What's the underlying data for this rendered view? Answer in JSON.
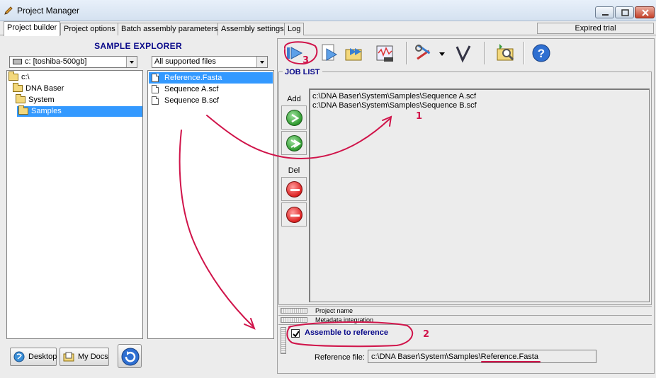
{
  "window": {
    "title": "Project Manager",
    "app_icon": "pencil-icon"
  },
  "tabs": [
    {
      "label": "Project builder",
      "active": true
    },
    {
      "label": "Project options",
      "active": false
    },
    {
      "label": "Batch assembly parameters",
      "active": false
    },
    {
      "label": "Assembly settings",
      "active": false
    },
    {
      "label": "Log",
      "active": false
    }
  ],
  "status": {
    "license": "Expired trial"
  },
  "explorer": {
    "title": "SAMPLE EXPLORER",
    "drive": "c: [toshiba-500gb]",
    "filter": "All supported files",
    "folders": [
      {
        "label": "c:\\",
        "level": 0,
        "selected": false
      },
      {
        "label": "DNA Baser",
        "level": 1,
        "selected": false
      },
      {
        "label": "System",
        "level": 2,
        "selected": false
      },
      {
        "label": "Samples",
        "level": 3,
        "selected": true
      }
    ],
    "files": [
      {
        "label": "Reference.Fasta",
        "selected": true
      },
      {
        "label": "Sequence A.scf",
        "selected": false
      },
      {
        "label": "Sequence B.scf",
        "selected": false
      }
    ],
    "buttons": {
      "desktop": "Desktop",
      "mydocs": "My Docs"
    }
  },
  "toolbar": {
    "icons": [
      "play-icon",
      "play-page-icon",
      "fast-forward-icon",
      "open-folder-icon",
      "blast-icon",
      "tools-icon",
      "dropdown-arrow-icon",
      "checkmark-v-icon",
      "search-folder-icon",
      "help-icon"
    ]
  },
  "joblist": {
    "title": "JOB LIST",
    "add_label": "Add",
    "del_label": "Del",
    "items": [
      "c:\\DNA Baser\\System\\Samples\\Sequence A.scf",
      "c:\\DNA Baser\\System\\Samples\\Sequence B.scf"
    ]
  },
  "sections": {
    "project_name": "Project name",
    "metadata": "Metadata integration"
  },
  "assemble": {
    "checkbox_label": "Assemble to reference",
    "checked": true,
    "ref_label": "Reference file:",
    "ref_value": "c:\\DNA Baser\\System\\Samples\\Reference.Fasta"
  },
  "annotations": [
    "1",
    "2",
    "3"
  ],
  "colors": {
    "accent_blue": "#0a0a8a",
    "selection": "#3399ff",
    "annotation": "#d0144a"
  }
}
